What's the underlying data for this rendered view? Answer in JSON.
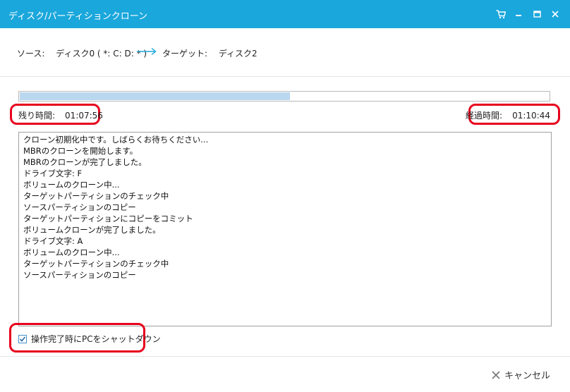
{
  "window": {
    "title": "ディスク/パーティションクローン"
  },
  "source": {
    "label": "ソース:",
    "value": "ディスク0 ( *: C: D: * )"
  },
  "target": {
    "label": "ターゲット:",
    "value": "ディスク2"
  },
  "progress": {
    "fraction": 0.51,
    "time_left_label": "残り時間:",
    "time_left": "01:07:56",
    "elapsed_label": "経過時間:",
    "elapsed": "01:10:44"
  },
  "log": [
    "クローン初期化中です。しばらくお待ちください...",
    "MBRのクローンを開始します。",
    "MBRのクローンが完了しました。",
    "ドライブ文字: F",
    "ボリュームのクローン中...",
    "ターゲットパーティションのチェック中",
    "ソースパーティションのコピー",
    "ターゲットパーティションにコピーをコミット",
    "ボリュームクローンが完了しました。",
    "ドライブ文字: A",
    "ボリュームのクローン中...",
    "ターゲットパーティションのチェック中",
    "ソースパーティションのコピー"
  ],
  "shutdown": {
    "label": "操作完了時にPCをシャットダウン",
    "checked": true
  },
  "footer": {
    "cancel_label": "キャンセル"
  },
  "colors": {
    "titlebar": "#1aa7dc",
    "progress_fill": "#b9d7ef",
    "highlight": "#e8001c",
    "arrow": "#1aa7dc"
  },
  "icons": {
    "cart": "cart-icon",
    "minimize": "minimize-icon",
    "maximize": "maximize-icon",
    "close": "close-icon",
    "arrow": "arrow-right-icon",
    "check": "check-icon",
    "cancel": "x-icon"
  }
}
